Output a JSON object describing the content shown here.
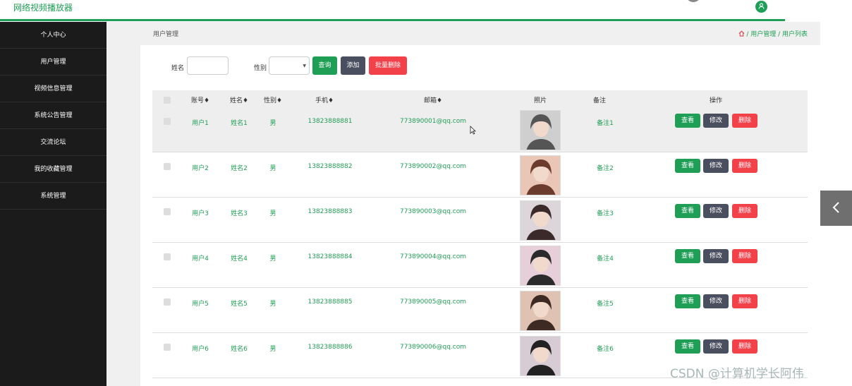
{
  "header": {
    "brand": "网络视频播放器"
  },
  "sidebar": {
    "items": [
      {
        "label": "个人中心"
      },
      {
        "label": "用户管理"
      },
      {
        "label": "视频信息管理"
      },
      {
        "label": "系统公告管理"
      },
      {
        "label": "交流论坛"
      },
      {
        "label": "我的收藏管理"
      },
      {
        "label": "系统管理"
      }
    ]
  },
  "breadcrumb": {
    "title": "用户管理",
    "path": "/ 用户管理 / 用户列表"
  },
  "search": {
    "name_label": "姓名",
    "name_value": "",
    "gender_label": "性别",
    "gender_value": "",
    "query_label": "查询",
    "add_label": "添加",
    "batch_delete_label": "批量删除"
  },
  "table": {
    "columns": [
      "账号",
      "姓名",
      "性别",
      "手机",
      "邮箱",
      "照片",
      "备注",
      "操作"
    ],
    "rows": [
      {
        "account": "用户1",
        "name": "姓名1",
        "gender": "男",
        "phone": "13823888881",
        "email": "773890001@qq.com",
        "note": "备注1"
      },
      {
        "account": "用户2",
        "name": "姓名2",
        "gender": "男",
        "phone": "13823888882",
        "email": "773890002@qq.com",
        "note": "备注2"
      },
      {
        "account": "用户3",
        "name": "姓名3",
        "gender": "男",
        "phone": "13823888883",
        "email": "773890003@qq.com",
        "note": "备注3"
      },
      {
        "account": "用户4",
        "name": "姓名4",
        "gender": "男",
        "phone": "13823888884",
        "email": "773890004@qq.com",
        "note": "备注4"
      },
      {
        "account": "用户5",
        "name": "姓名5",
        "gender": "男",
        "phone": "13823888885",
        "email": "773890005@qq.com",
        "note": "备注5"
      },
      {
        "account": "用户6",
        "name": "姓名6",
        "gender": "男",
        "phone": "13823888886",
        "email": "773890006@qq.com",
        "note": "备注6"
      }
    ],
    "actions": {
      "view": "查看",
      "edit": "修改",
      "delete": "删除"
    }
  },
  "watermark": "CSDN @计算机学长阿伟",
  "colors": {
    "accent": "#1f9e55",
    "sidebar": "#1b1b1b",
    "dark_button": "#4a4f60",
    "danger": "#f3414a"
  },
  "icons": {
    "home": "home-icon",
    "user": "user-icon",
    "collapse": "chevron-left-icon",
    "cursor": "mouse-cursor-icon",
    "dropdown": "caret-down-icon"
  }
}
